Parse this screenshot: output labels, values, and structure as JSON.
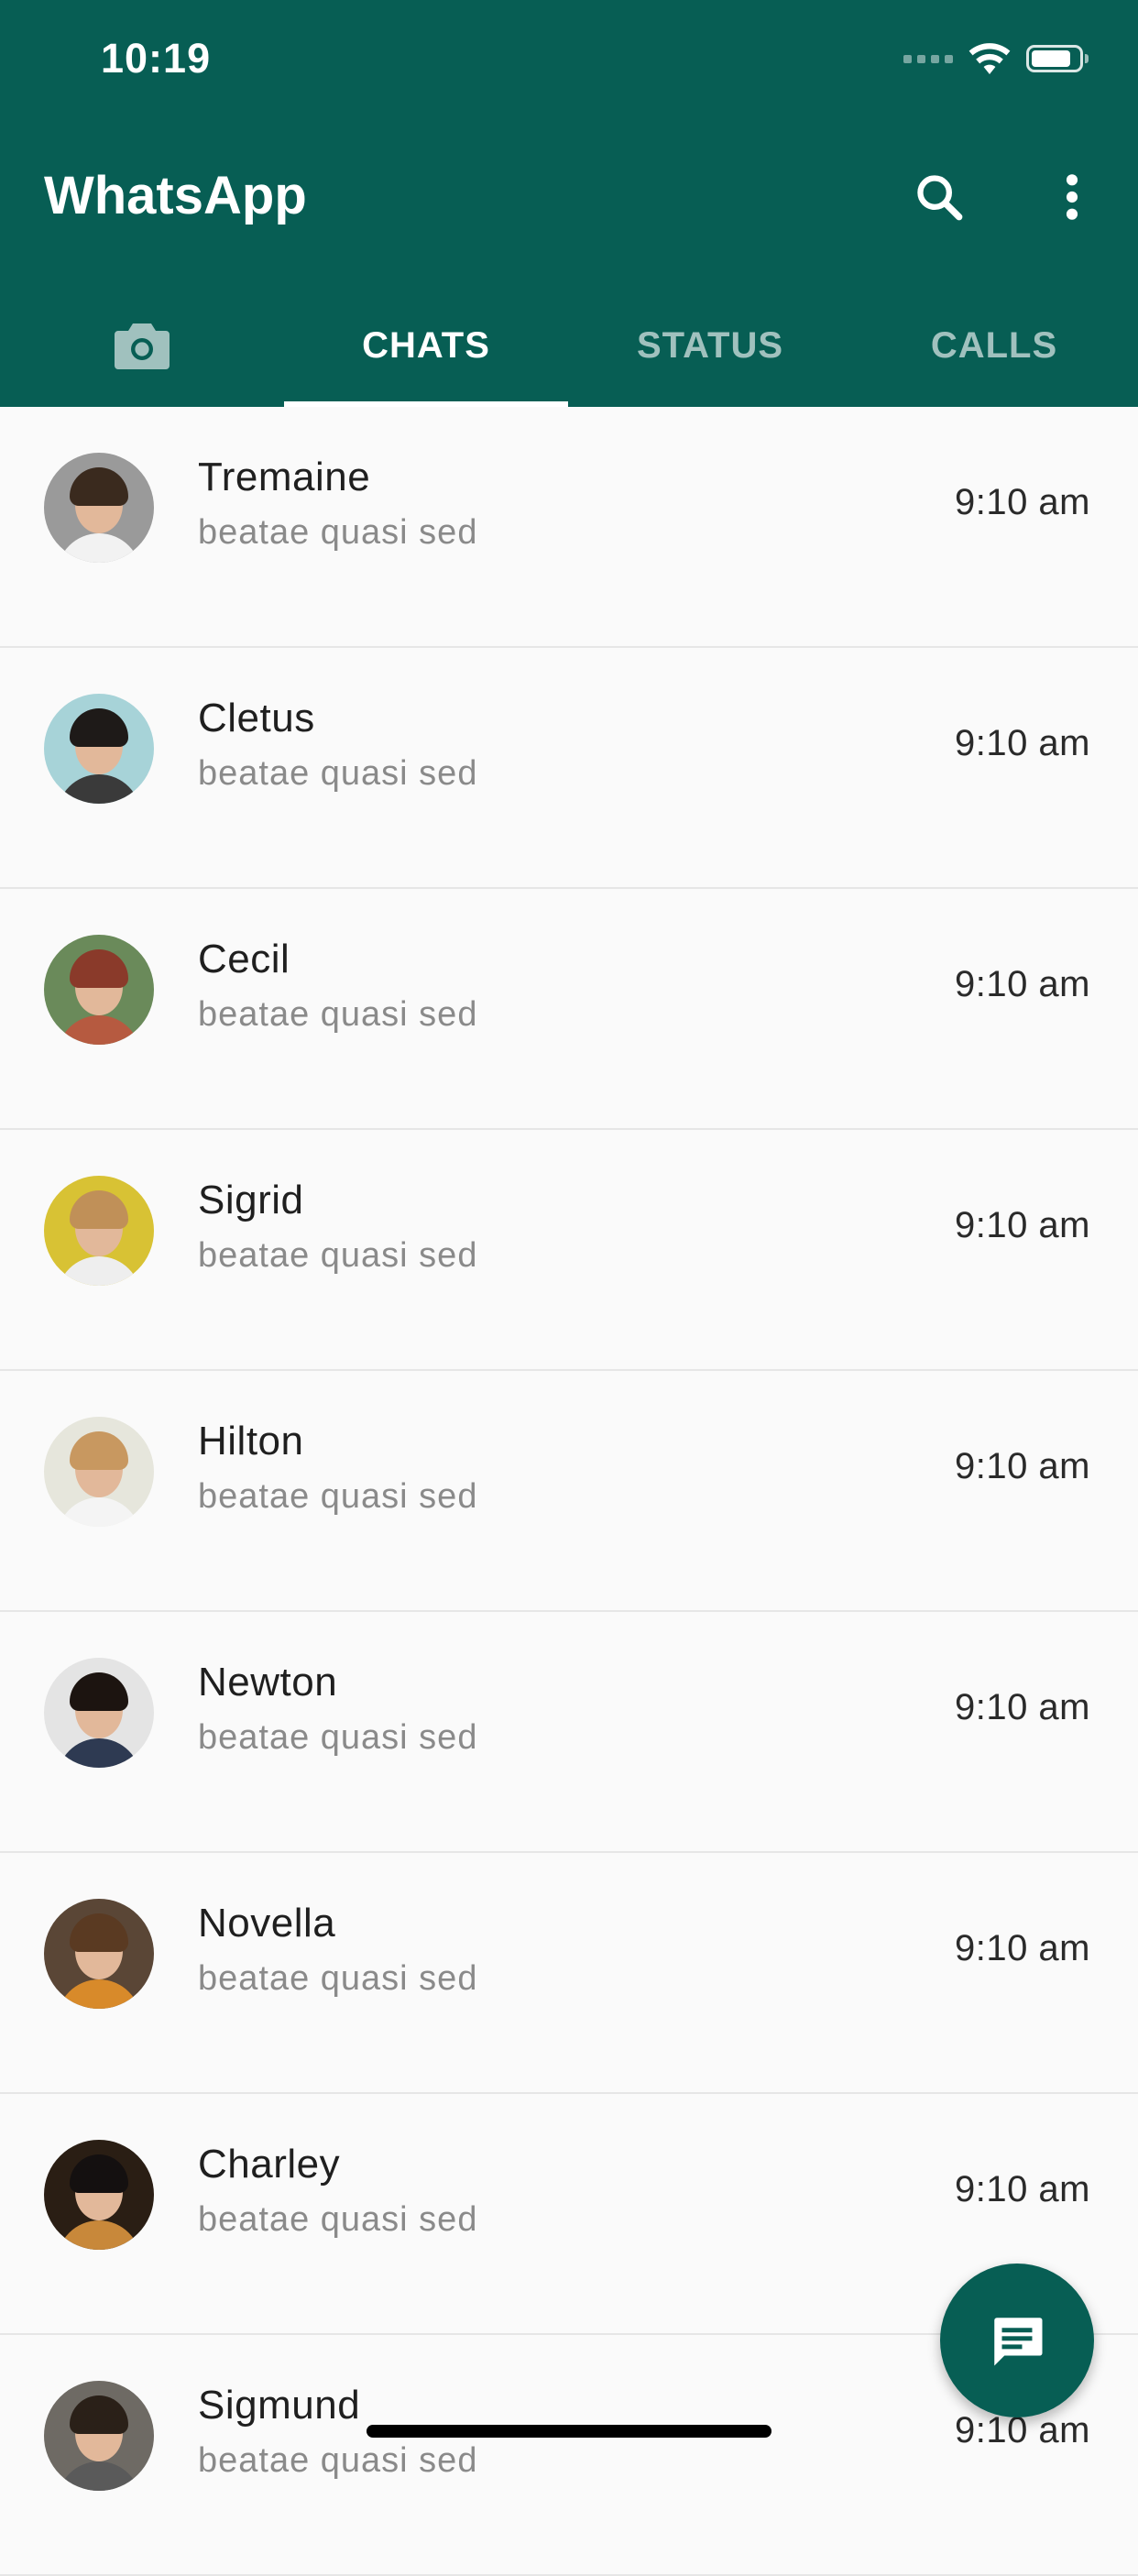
{
  "status_bar": {
    "time": "10:19"
  },
  "app_bar": {
    "title": "WhatsApp",
    "search_icon": "search-icon",
    "menu_icon": "more-vert-icon"
  },
  "tabs": [
    {
      "label": "",
      "icon": "camera-icon",
      "active": false
    },
    {
      "label": "CHATS",
      "active": true
    },
    {
      "label": "STATUS",
      "active": false
    },
    {
      "label": "CALLS",
      "active": false
    }
  ],
  "chats": [
    {
      "name": "Tremaine",
      "message": "beatae quasi sed",
      "time": "9:10 am"
    },
    {
      "name": "Cletus",
      "message": "beatae quasi sed",
      "time": "9:10 am"
    },
    {
      "name": "Cecil",
      "message": "beatae quasi sed",
      "time": "9:10 am"
    },
    {
      "name": "Sigrid",
      "message": "beatae quasi sed",
      "time": "9:10 am"
    },
    {
      "name": "Hilton",
      "message": "beatae quasi sed",
      "time": "9:10 am"
    },
    {
      "name": "Newton",
      "message": "beatae quasi sed",
      "time": "9:10 am"
    },
    {
      "name": "Novella",
      "message": "beatae quasi sed",
      "time": "9:10 am"
    },
    {
      "name": "Charley",
      "message": "beatae quasi sed",
      "time": "9:10 am"
    },
    {
      "name": "Sigmund",
      "message": "beatae quasi sed",
      "time": "9:10 am"
    }
  ],
  "fab": {
    "icon": "new-chat-icon"
  },
  "colors": {
    "primary": "#075e54",
    "background": "#fafafa"
  }
}
